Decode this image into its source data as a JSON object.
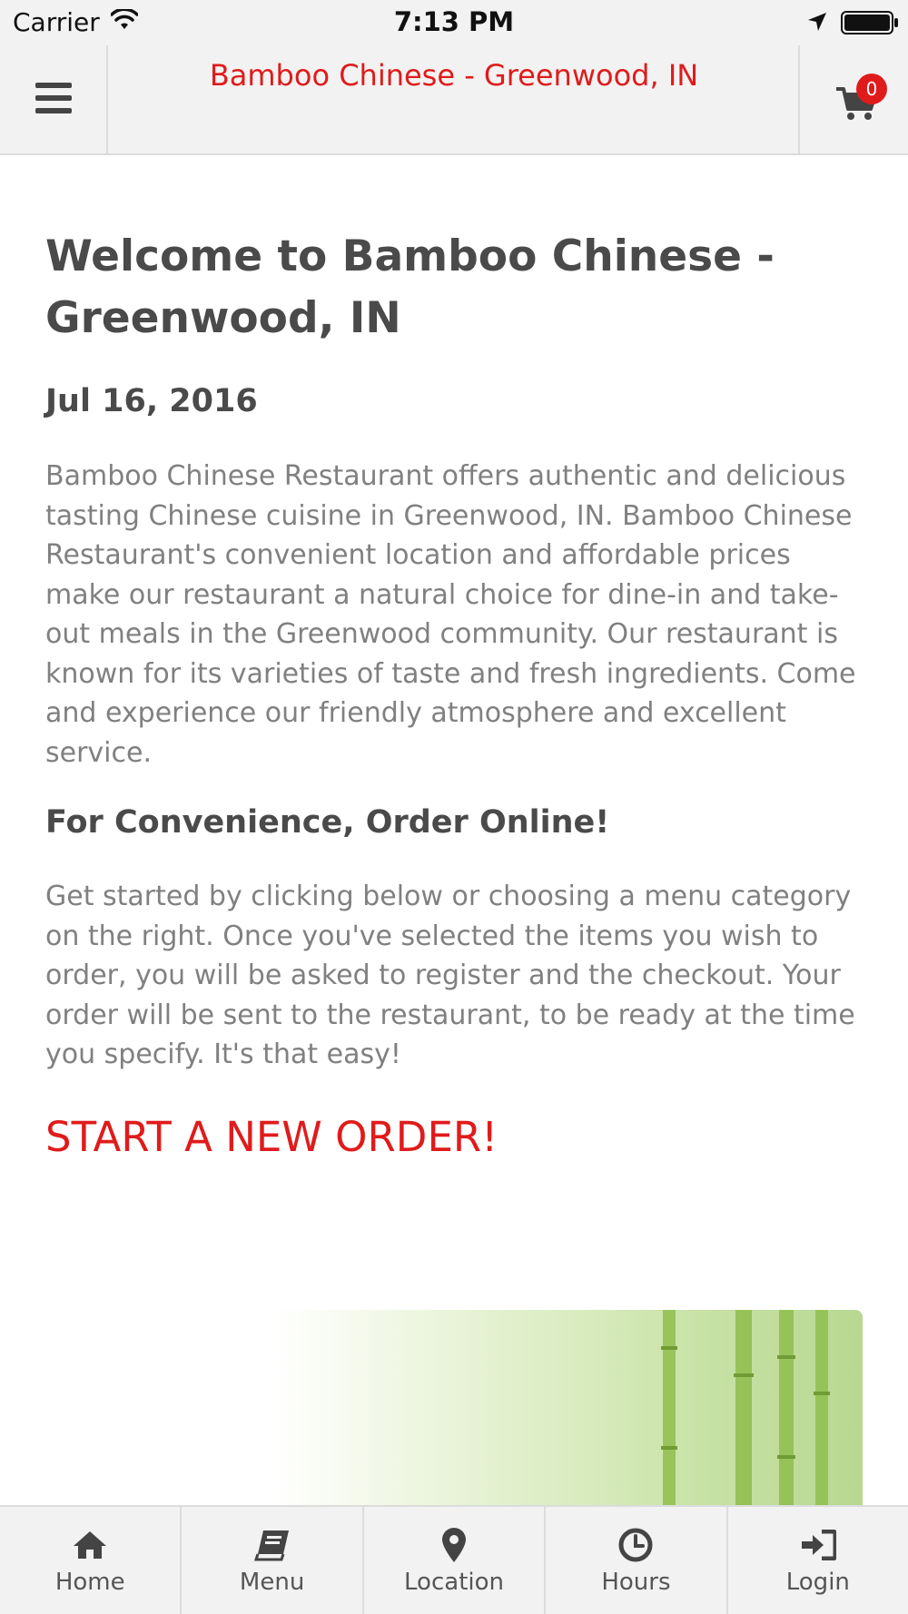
{
  "status_bar": {
    "carrier": "Carrier",
    "time": "7:13 PM",
    "icons": [
      "wifi-icon",
      "location-arrow-icon",
      "battery-icon"
    ]
  },
  "header": {
    "title": "Bamboo Chinese - Greenwood, IN",
    "menu_icon": "hamburger-icon",
    "cart_icon": "cart-icon",
    "cart_count": "0",
    "accent_color": "#e01b1b"
  },
  "main": {
    "title": "Welcome to Bamboo Chinese - Greenwood, IN",
    "date": "Jul 16, 2016",
    "intro": "Bamboo Chinese Restaurant offers authentic and delicious tasting Chinese cuisine in Greenwood, IN. Bamboo Chinese Restaurant's convenient location and affordable prices make our restaurant a natural choice for dine-in and take-out meals in the Greenwood community. Our restaurant is known for its varieties of taste and fresh ingredients. Come and experience our friendly atmosphere and excellent service.",
    "section_heading": "For Convenience, Order Online!",
    "order_text": "Get started by clicking below or choosing a menu category on the right. Once you've selected the items you wish to order, you will be asked to register and the checkout. Your order will be sent to the restaurant, to be ready at the time you specify. It's that easy!",
    "cta": "START A NEW ORDER!"
  },
  "tabs": [
    {
      "label": "Home",
      "icon": "home-icon"
    },
    {
      "label": "Menu",
      "icon": "book-icon"
    },
    {
      "label": "Location",
      "icon": "map-marker-icon"
    },
    {
      "label": "Hours",
      "icon": "clock-icon"
    },
    {
      "label": "Login",
      "icon": "sign-in-icon"
    }
  ]
}
